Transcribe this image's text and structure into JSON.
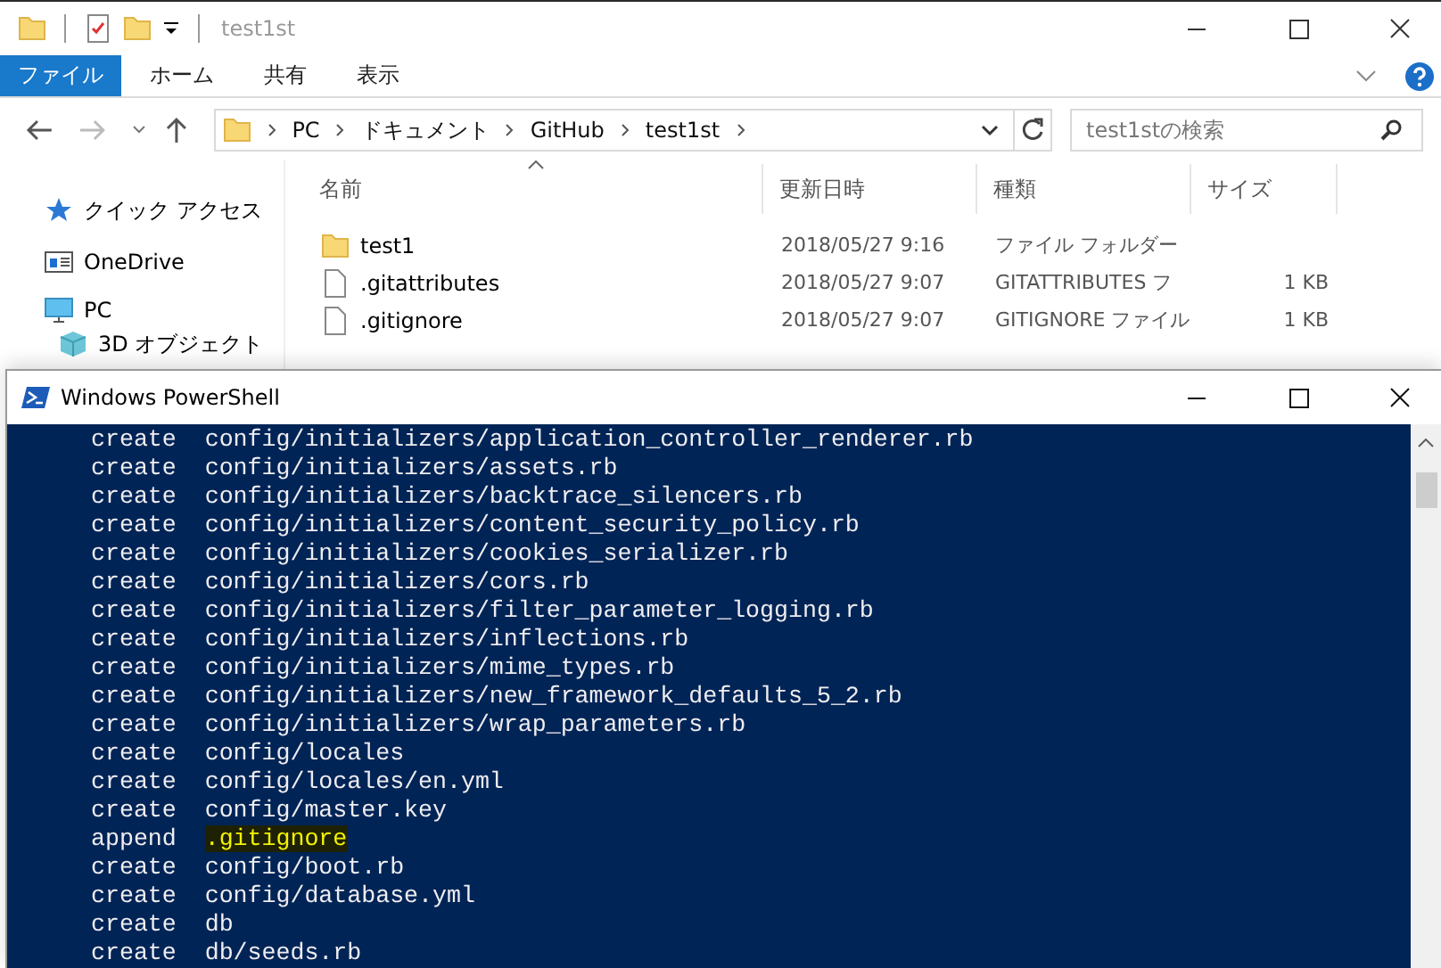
{
  "explorer": {
    "title": "test1st",
    "ribbon_tabs": [
      {
        "label": "ファイル",
        "selected": true
      },
      {
        "label": "ホーム",
        "selected": false
      },
      {
        "label": "共有",
        "selected": false
      },
      {
        "label": "表示",
        "selected": false
      }
    ],
    "breadcrumb": [
      "PC",
      "ドキュメント",
      "GitHub",
      "test1st"
    ],
    "search": {
      "placeholder": "test1stの検索"
    },
    "nav_items": [
      {
        "label": "クイック アクセス",
        "kind": "quick"
      },
      {
        "label": "OneDrive",
        "kind": "cloud"
      },
      {
        "label": "PC",
        "kind": "pc",
        "children": [
          {
            "label": "3D オブジェクト",
            "kind": "objects"
          }
        ]
      }
    ],
    "columns": [
      "名前",
      "更新日時",
      "種類",
      "サイズ"
    ],
    "files": [
      {
        "kind": "folder",
        "name": "test1",
        "modified": "2018/05/27 9:16",
        "type": "ファイル フォルダー"
      },
      {
        "kind": "file",
        "name": ".gitattributes",
        "modified": "2018/05/27 9:07",
        "type": "GITATTRIBUTES フ",
        "size": "1 KB"
      },
      {
        "kind": "file",
        "name": ".gitignore",
        "modified": "2018/05/27 9:07",
        "type": "GITIGNORE ファイル",
        "size": "1 KB"
      }
    ]
  },
  "powershell": {
    "title": "Windows PowerShell",
    "lines": [
      {
        "action": "create",
        "path": "config/initializers/application_controller_renderer.rb",
        "highlighted": false
      },
      {
        "action": "create",
        "path": "config/initializers/assets.rb",
        "highlighted": false
      },
      {
        "action": "create",
        "path": "config/initializers/backtrace_silencers.rb",
        "highlighted": false
      },
      {
        "action": "create",
        "path": "config/initializers/content_security_policy.rb",
        "highlighted": false
      },
      {
        "action": "create",
        "path": "config/initializers/cookies_serializer.rb",
        "highlighted": false
      },
      {
        "action": "create",
        "path": "config/initializers/cors.rb",
        "highlighted": false
      },
      {
        "action": "create",
        "path": "config/initializers/filter_parameter_logging.rb",
        "highlighted": false
      },
      {
        "action": "create",
        "path": "config/initializers/inflections.rb",
        "highlighted": false
      },
      {
        "action": "create",
        "path": "config/initializers/mime_types.rb",
        "highlighted": false
      },
      {
        "action": "create",
        "path": "config/initializers/new_framework_defaults_5_2.rb",
        "highlighted": false
      },
      {
        "action": "create",
        "path": "config/initializers/wrap_parameters.rb",
        "highlighted": false
      },
      {
        "action": "create",
        "path": "config/locales",
        "highlighted": false
      },
      {
        "action": "create",
        "path": "config/locales/en.yml",
        "highlighted": false
      },
      {
        "action": "create",
        "path": "config/master.key",
        "highlighted": false
      },
      {
        "action": "append",
        "path": ".gitignore",
        "highlighted": true
      },
      {
        "action": "create",
        "path": "config/boot.rb",
        "highlighted": false
      },
      {
        "action": "create",
        "path": "config/database.yml",
        "highlighted": false
      },
      {
        "action": "create",
        "path": "db",
        "highlighted": false
      },
      {
        "action": "create",
        "path": "db/seeds.rb",
        "highlighted": false
      }
    ]
  }
}
